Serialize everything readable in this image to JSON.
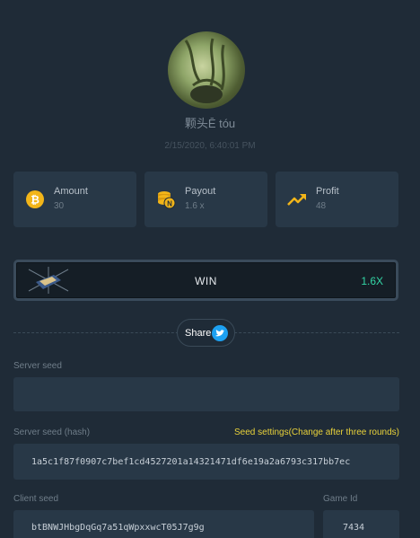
{
  "profile": {
    "username": "颗头Ē tóu",
    "timestamp": "2/15/2020, 6:40:01 PM"
  },
  "stats": [
    {
      "label": "Amount",
      "value": "30",
      "icon": "bitcoin-coin-icon"
    },
    {
      "label": "Payout",
      "value": "1.6 x",
      "icon": "coin-stack-icon"
    },
    {
      "label": "Profit",
      "value": "48",
      "icon": "trend-up-icon"
    }
  ],
  "result": {
    "label": "WIN",
    "multiplier": "1.6X"
  },
  "share": {
    "label": "Share"
  },
  "server_seed": {
    "label": "Server seed",
    "value": ""
  },
  "server_seed_hash": {
    "label": "Server seed (hash)",
    "settings_link": "Seed settings(Change after three rounds)",
    "value": "1a5c1f87f0907c7bef1cd4527201a14321471df6e19a2a6793c317bb7ec"
  },
  "client_seed": {
    "label": "Client seed",
    "value": "btBNWJHbgDqGq7a51qWpxxwcT05J7g9g"
  },
  "game_id": {
    "label": "Game Id",
    "value": "7434"
  },
  "colors": {
    "background": "#1f2b37",
    "card": "#283847",
    "win_accent": "#33d6a6",
    "link": "#e9d23a",
    "twitter": "#1da1f2"
  }
}
